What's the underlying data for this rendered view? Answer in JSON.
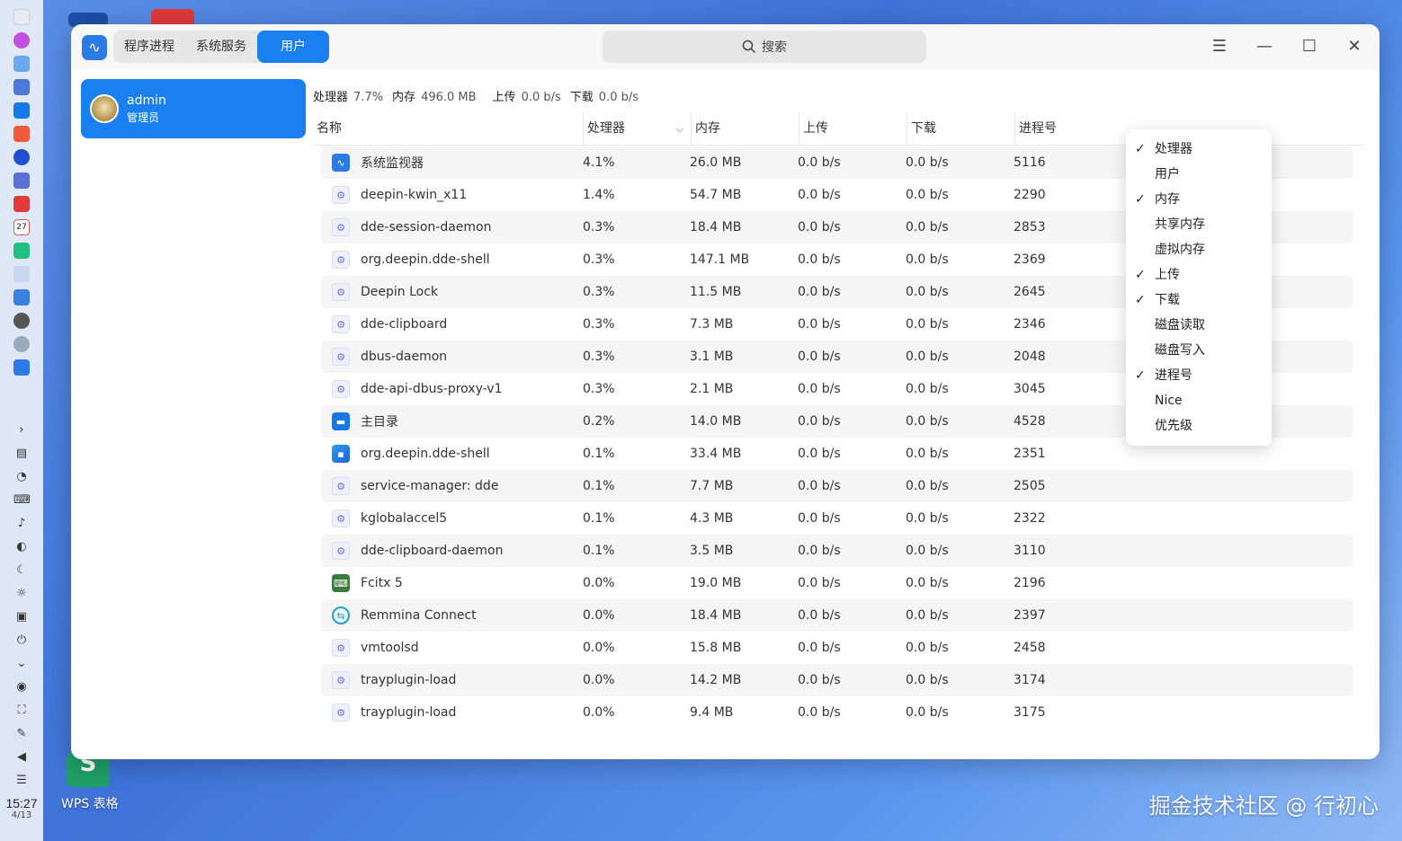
{
  "desktop": {
    "wps_label": "WPS 表格",
    "watermark": "掘金技术社区 @ 行初心"
  },
  "dock": {
    "time": "15:27",
    "date": "4/13"
  },
  "window": {
    "tabs": [
      {
        "label": "程序进程",
        "active": false
      },
      {
        "label": "系统服务",
        "active": false
      },
      {
        "label": "用户",
        "active": true
      }
    ],
    "search_placeholder": "搜索",
    "controls": {
      "menu": "☰",
      "minimize": "—",
      "maximize": "☐",
      "close": "✕"
    }
  },
  "user": {
    "name": "admin",
    "role": "管理员"
  },
  "summary": {
    "cpu_label": "处理器",
    "cpu_value": "7.7%",
    "mem_label": "内存",
    "mem_value": "496.0 MB",
    "up_label": "上传",
    "up_value": "0.0 b/s",
    "down_label": "下载",
    "down_value": "0.0 b/s"
  },
  "table": {
    "headers": {
      "name": "名称",
      "cpu": "处理器",
      "mem": "内存",
      "up": "上传",
      "down": "下载",
      "pid": "进程号"
    },
    "rows": [
      {
        "icon": "monitor",
        "name": "系统监视器",
        "cpu": "4.1%",
        "mem": "26.0 MB",
        "up": "0.0 b/s",
        "down": "0.0 b/s",
        "pid": "5116"
      },
      {
        "icon": "generic",
        "name": "deepin-kwin_x11",
        "cpu": "1.4%",
        "mem": "54.7 MB",
        "up": "0.0 b/s",
        "down": "0.0 b/s",
        "pid": "2290"
      },
      {
        "icon": "generic",
        "name": "dde-session-daemon",
        "cpu": "0.3%",
        "mem": "18.4 MB",
        "up": "0.0 b/s",
        "down": "0.0 b/s",
        "pid": "2853"
      },
      {
        "icon": "generic",
        "name": "org.deepin.dde-shell",
        "cpu": "0.3%",
        "mem": "147.1 MB",
        "up": "0.0 b/s",
        "down": "0.0 b/s",
        "pid": "2369"
      },
      {
        "icon": "generic",
        "name": "Deepin Lock",
        "cpu": "0.3%",
        "mem": "11.5 MB",
        "up": "0.0 b/s",
        "down": "0.0 b/s",
        "pid": "2645"
      },
      {
        "icon": "generic",
        "name": "dde-clipboard",
        "cpu": "0.3%",
        "mem": "7.3 MB",
        "up": "0.0 b/s",
        "down": "0.0 b/s",
        "pid": "2346"
      },
      {
        "icon": "generic",
        "name": "dbus-daemon",
        "cpu": "0.3%",
        "mem": "3.1 MB",
        "up": "0.0 b/s",
        "down": "0.0 b/s",
        "pid": "2048"
      },
      {
        "icon": "generic",
        "name": "dde-api-dbus-proxy-v1",
        "cpu": "0.3%",
        "mem": "2.1 MB",
        "up": "0.0 b/s",
        "down": "0.0 b/s",
        "pid": "3045"
      },
      {
        "icon": "home",
        "name": "主目录",
        "cpu": "0.2%",
        "mem": "14.0 MB",
        "up": "0.0 b/s",
        "down": "0.0 b/s",
        "pid": "4528"
      },
      {
        "icon": "shell",
        "name": "org.deepin.dde-shell",
        "cpu": "0.1%",
        "mem": "33.4 MB",
        "up": "0.0 b/s",
        "down": "0.0 b/s",
        "pid": "2351"
      },
      {
        "icon": "generic",
        "name": "service-manager: dde",
        "cpu": "0.1%",
        "mem": "7.7 MB",
        "up": "0.0 b/s",
        "down": "0.0 b/s",
        "pid": "2505"
      },
      {
        "icon": "generic",
        "name": "kglobalaccel5",
        "cpu": "0.1%",
        "mem": "4.3 MB",
        "up": "0.0 b/s",
        "down": "0.0 b/s",
        "pid": "2322"
      },
      {
        "icon": "generic",
        "name": "dde-clipboard-daemon",
        "cpu": "0.1%",
        "mem": "3.5 MB",
        "up": "0.0 b/s",
        "down": "0.0 b/s",
        "pid": "3110"
      },
      {
        "icon": "fcitx",
        "name": "Fcitx 5",
        "cpu": "0.0%",
        "mem": "19.0 MB",
        "up": "0.0 b/s",
        "down": "0.0 b/s",
        "pid": "2196"
      },
      {
        "icon": "remmina",
        "name": "Remmina Connect",
        "cpu": "0.0%",
        "mem": "18.4 MB",
        "up": "0.0 b/s",
        "down": "0.0 b/s",
        "pid": "2397"
      },
      {
        "icon": "generic",
        "name": "vmtoolsd",
        "cpu": "0.0%",
        "mem": "15.8 MB",
        "up": "0.0 b/s",
        "down": "0.0 b/s",
        "pid": "2458"
      },
      {
        "icon": "generic",
        "name": "trayplugin-load",
        "cpu": "0.0%",
        "mem": "14.2 MB",
        "up": "0.0 b/s",
        "down": "0.0 b/s",
        "pid": "3174"
      },
      {
        "icon": "generic",
        "name": "trayplugin-load",
        "cpu": "0.0%",
        "mem": "9.4 MB",
        "up": "0.0 b/s",
        "down": "0.0 b/s",
        "pid": "3175"
      }
    ]
  },
  "column_menu": [
    {
      "label": "处理器",
      "checked": true
    },
    {
      "label": "用户",
      "checked": false
    },
    {
      "label": "内存",
      "checked": true
    },
    {
      "label": "共享内存",
      "checked": false
    },
    {
      "label": "虚拟内存",
      "checked": false
    },
    {
      "label": "上传",
      "checked": true
    },
    {
      "label": "下载",
      "checked": true
    },
    {
      "label": "磁盘读取",
      "checked": false
    },
    {
      "label": "磁盘写入",
      "checked": false
    },
    {
      "label": "进程号",
      "checked": true
    },
    {
      "label": "Nice",
      "checked": false
    },
    {
      "label": "优先级",
      "checked": false
    }
  ],
  "colors": {
    "accent": "#1a7ff0",
    "row_alt": "#f5f5f5"
  }
}
